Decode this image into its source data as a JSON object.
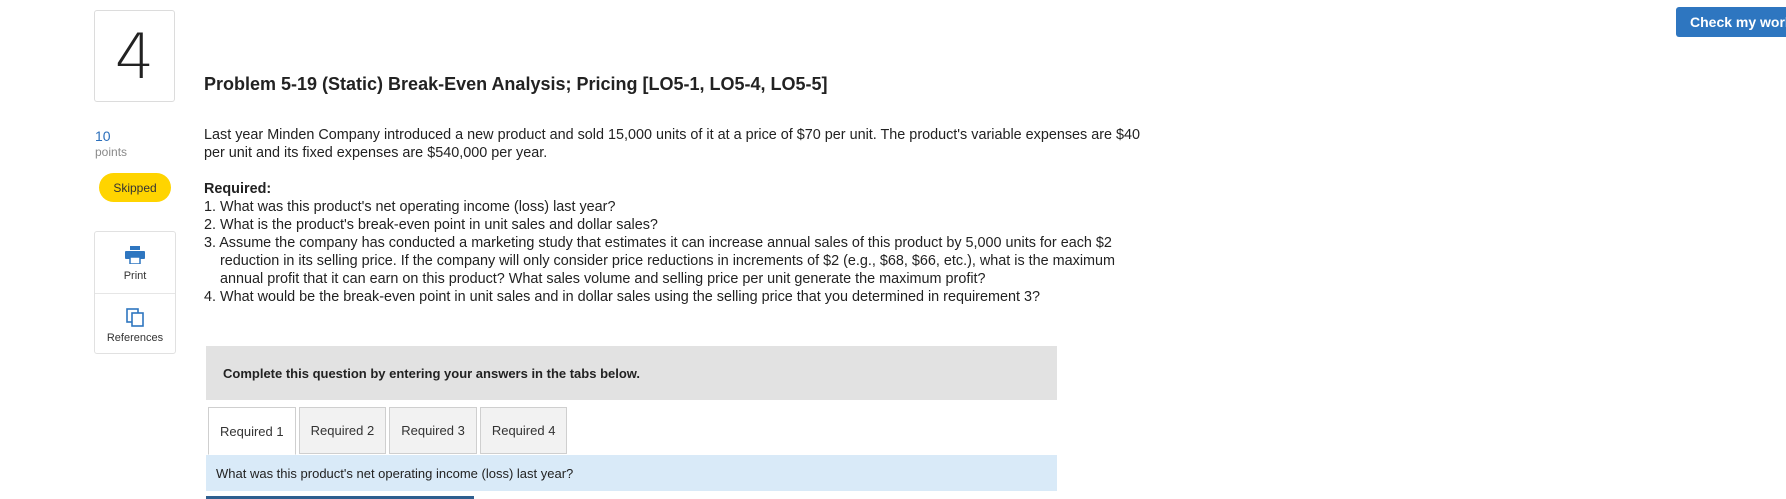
{
  "question_number": "4",
  "points": {
    "value": "10",
    "label": "points"
  },
  "status_badge": "Skipped",
  "tools": {
    "print_label": "Print",
    "references_label": "References"
  },
  "check_button": "Check my work",
  "title": "Problem 5-19 (Static) Break-Even Analysis; Pricing [LO5-1, LO5-4, LO5-5]",
  "intro": "Last year Minden Company introduced a new product and sold 15,000 units of it at a price of $70 per unit. The product's variable expenses are $40 per unit and its fixed expenses are $540,000 per year.",
  "required_heading": "Required:",
  "requirements": [
    "1. What was this product's net operating income (loss) last year?",
    "2. What is the product's break-even point in unit sales and dollar sales?",
    "3. Assume the company has conducted a marketing study that estimates it can increase annual sales of this product by 5,000 units for each $2 reduction in its selling price. If the company will only consider price reductions in increments of $2 (e.g., $68, $66, etc.), what is the maximum annual profit that it can earn on this product? What sales volume and selling price per unit generate the maximum profit?",
    "4. What would be the break-even point in unit sales and in dollar sales using the selling price that you determined in requirement 3?"
  ],
  "instruction": "Complete this question by entering your answers in the tabs below.",
  "tabs": [
    "Required 1",
    "Required 2",
    "Required 3",
    "Required 4"
  ],
  "active_tab": "Required 1",
  "tab_prompt": "What was this product's net operating income (loss) last year?",
  "colors": {
    "accent": "#2e76c0",
    "badge": "#ffd400",
    "prompt_bg": "#d9eaf8",
    "instruction_bg": "#e2e2e2"
  },
  "icons": {
    "print": "printer-icon",
    "references": "copy-pages-icon"
  }
}
